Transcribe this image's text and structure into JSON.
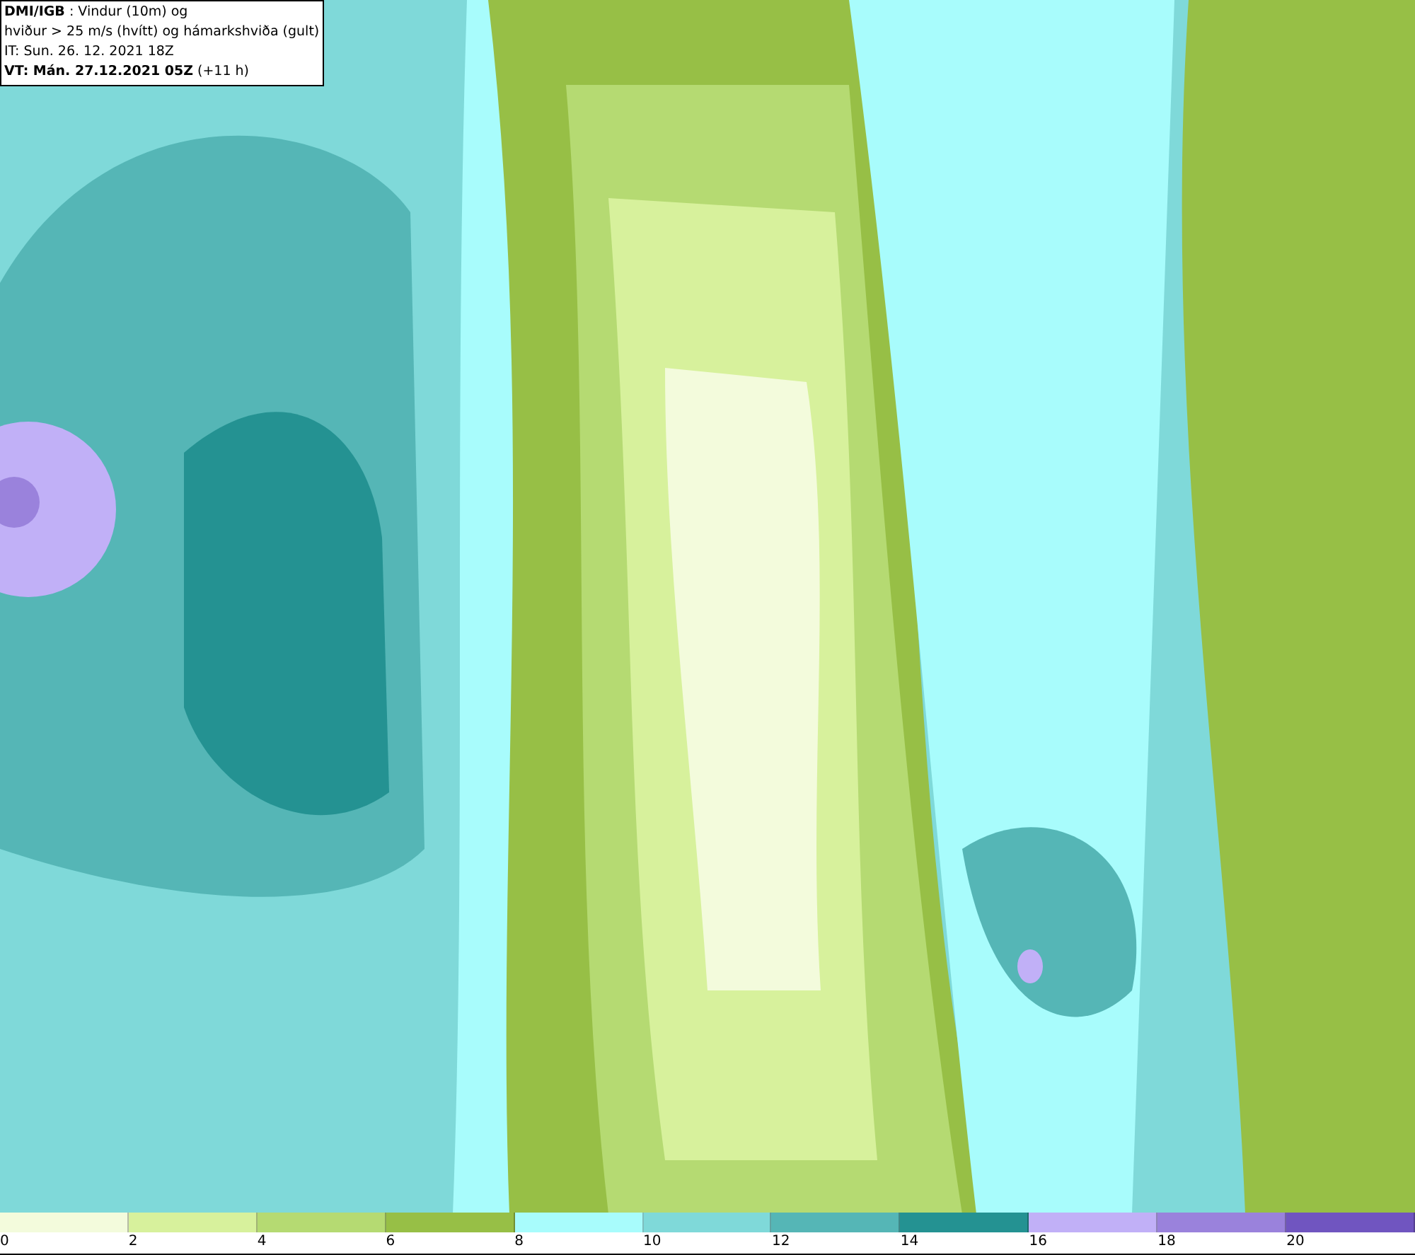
{
  "header": {
    "lines": [
      "**DMI/IGB** : Vindur (10m) og",
      "hviður > 25 m/s (hvítt) og hámarkshviða (gult)",
      "IT: Sun. 26. 12. 2021 18Z",
      "**VT: Mán. 27.12.2021 05Z** (+11 h)"
    ]
  },
  "legend": {
    "segments": [
      {
        "color": "#f3fbdc"
      },
      {
        "color": "#d7f19c"
      },
      {
        "color": "#b5da72"
      },
      {
        "color": "#97bf46"
      },
      {
        "color": "#a8fcfc"
      },
      {
        "color": "#7fd9d9"
      },
      {
        "color": "#55b6b6"
      },
      {
        "color": "#249292"
      },
      {
        "color": "#c1b0f7"
      },
      {
        "color": "#9a82dc"
      },
      {
        "color": "#7055c0"
      }
    ],
    "labels": [
      "0",
      "2",
      "4",
      "6",
      "8",
      "10",
      "12",
      "14",
      "16",
      "18",
      "20"
    ]
  }
}
